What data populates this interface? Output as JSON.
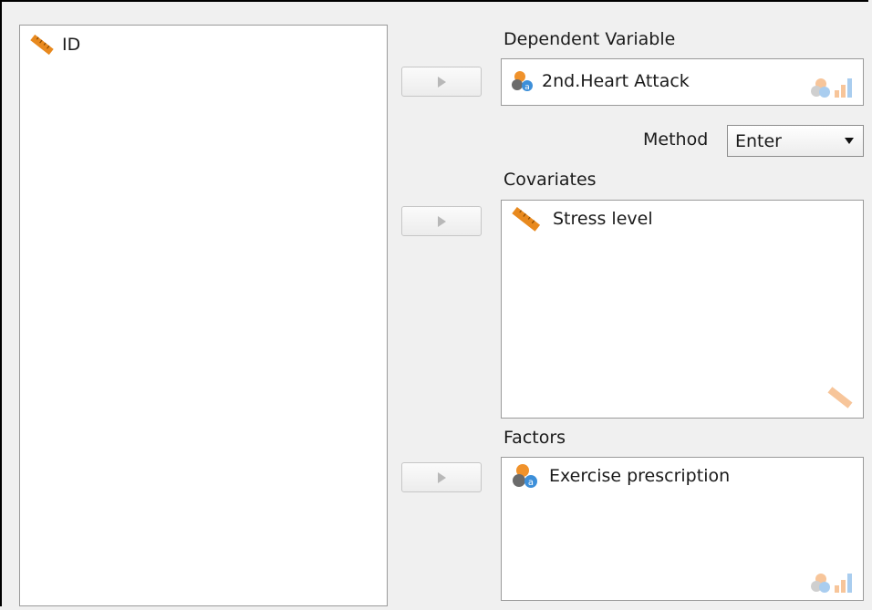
{
  "source_list": {
    "items": [
      {
        "label": "ID",
        "icon": "ruler-icon"
      }
    ]
  },
  "dependent": {
    "title": "Dependent Variable",
    "items": [
      {
        "label": "2nd.Heart Attack",
        "icon": "nominal-text-icon"
      }
    ],
    "allowed_icons": [
      "nominal-icon",
      "ordinal-icon"
    ]
  },
  "method": {
    "label": "Method",
    "selected": "Enter"
  },
  "covariates": {
    "title": "Covariates",
    "items": [
      {
        "label": "Stress level",
        "icon": "ruler-icon"
      }
    ],
    "allowed_icons": [
      "ruler-icon"
    ]
  },
  "factors": {
    "title": "Factors",
    "items": [
      {
        "label": "Exercise prescription",
        "icon": "nominal-text-icon"
      }
    ],
    "allowed_icons": [
      "nominal-icon",
      "ordinal-icon"
    ]
  },
  "colors": {
    "ruler": "#e8891e",
    "accent_blue": "#3d8fd9"
  }
}
